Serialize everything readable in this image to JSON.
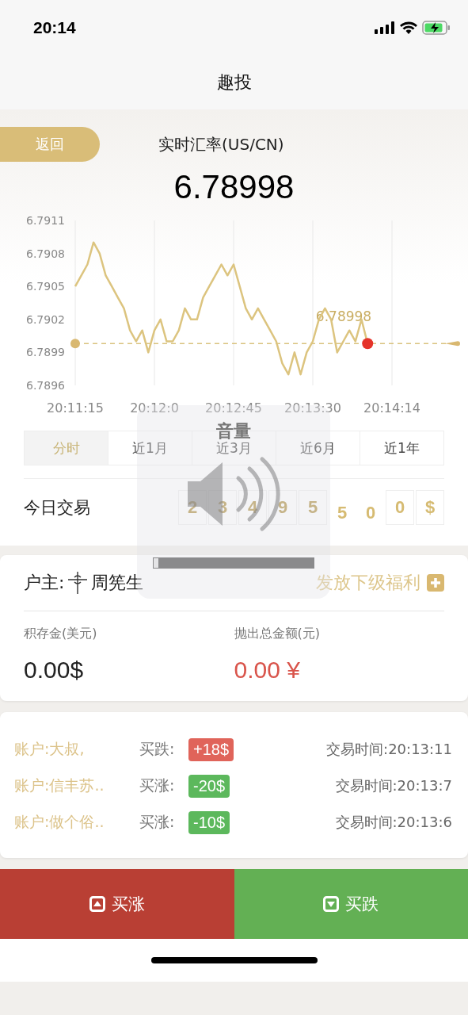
{
  "status_bar": {
    "time": "20:14"
  },
  "nav": {
    "title": "趣投"
  },
  "header": {
    "back": "返回",
    "title": "实时汇率(US/CN)",
    "rate": "6.78998"
  },
  "chart": {
    "chart_data": {
      "type": "line",
      "grid": true,
      "ref_lines": [
        {
          "axis": "y",
          "value": 6.78998,
          "label": "6.78998"
        }
      ],
      "categories": [
        "20:11:15",
        null,
        null,
        null,
        null,
        null,
        null,
        null,
        null,
        null,
        null,
        null,
        null,
        "20:12:0",
        null,
        null,
        null,
        null,
        null,
        null,
        null,
        null,
        null,
        null,
        null,
        null,
        "20:12:45",
        null,
        null,
        null,
        null,
        null,
        null,
        null,
        null,
        null,
        null,
        null,
        null,
        "20:13:30",
        null,
        null,
        null,
        null,
        null,
        null,
        null,
        null,
        null,
        null,
        null,
        null,
        "20:14:14"
      ],
      "series": [
        {
          "color": "#dcc47f",
          "values": [
            6.7905,
            6.7906,
            6.7907,
            6.7909,
            6.7908,
            6.7906,
            6.7905,
            6.7904,
            6.7903,
            6.7901,
            6.79,
            6.7901,
            6.7899,
            6.7901,
            6.7902,
            6.79,
            6.79,
            6.7901,
            6.7903,
            6.7902,
            6.7902,
            6.7904,
            6.7905,
            6.7906,
            6.7907,
            6.7906,
            6.7907,
            6.7905,
            6.7903,
            6.7902,
            6.7903,
            6.7902,
            6.7901,
            6.79,
            6.7898,
            6.7897,
            6.7899,
            6.7897,
            6.7899,
            6.79,
            6.7902,
            6.7903,
            6.7902,
            6.7899,
            6.79,
            6.7901,
            6.79,
            6.7902,
            6.78998,
            null,
            null,
            null,
            null
          ]
        }
      ],
      "ylim": [
        6.7896,
        6.7911
      ],
      "yticks": [
        {
          "value": 6.7911,
          "label": "6.7911"
        },
        {
          "value": 6.7908,
          "label": "6.7908"
        },
        {
          "value": 6.7905,
          "label": "6.7905"
        },
        {
          "value": 6.7902,
          "label": "6.7902"
        },
        {
          "value": 6.7899,
          "label": "6.7899"
        },
        {
          "value": 6.7896,
          "label": "6.7896"
        }
      ]
    }
  },
  "periods": [
    {
      "label": "分时",
      "selected": true
    },
    {
      "label": "近1月",
      "selected": false
    },
    {
      "label": "近3月",
      "selected": false
    },
    {
      "label": "近6月",
      "selected": false
    },
    {
      "label": "近1年",
      "selected": false
    }
  ],
  "today": {
    "label": "今日交易",
    "digits": [
      {
        "text": "2",
        "kind": "faded"
      },
      {
        "text": "3",
        "kind": "faded"
      },
      {
        "text": "4",
        "kind": "faded"
      },
      {
        "text": "9",
        "kind": "faded"
      },
      {
        "text": "5",
        "kind": "faded"
      },
      {
        "text": "5",
        "kind": "rolling"
      },
      {
        "text": "0",
        "kind": "rolling"
      },
      {
        "text": "0",
        "kind": "box"
      },
      {
        "text": "$",
        "kind": "box"
      }
    ]
  },
  "account": {
    "owner_label": "户主:",
    "owner_name": "周筅生",
    "welfare": "发放下级福利",
    "stats": [
      {
        "label": "积存金(美元)",
        "value": "0.00$",
        "kind": "dark"
      },
      {
        "label": "抛出总金额(元)",
        "value": "0.00 ¥",
        "kind": "red"
      }
    ]
  },
  "feed": [
    {
      "account": "账户:大叔,",
      "action": "买跌:",
      "amount": "+18$",
      "color": "#e0645a",
      "time": "交易时间:20:13:11"
    },
    {
      "account": "账户:信丰苏..",
      "action": "买涨:",
      "amount": "-20$",
      "color": "#5cb85c",
      "time": "交易时间:20:13:7"
    },
    {
      "account": "账户:做个俗..",
      "action": "买涨:",
      "amount": "-10$",
      "color": "#5cb85c",
      "time": "交易时间:20:13:6"
    }
  ],
  "actions": [
    {
      "label": "买涨",
      "kind": "up"
    },
    {
      "label": "买跌",
      "kind": "down"
    }
  ],
  "volume_hud": {
    "title": "音量",
    "level": 0.03
  }
}
